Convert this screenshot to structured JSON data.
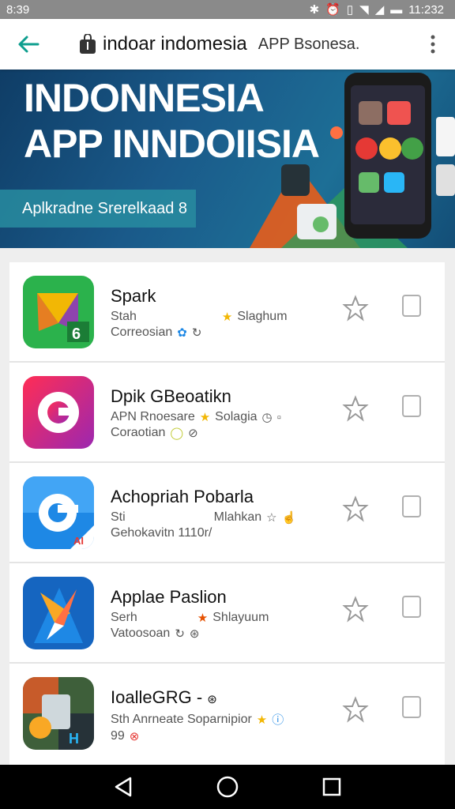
{
  "status_bar": {
    "left_text": "8:39",
    "time": "11:232",
    "icons": [
      "bluetooth-icon",
      "alarm-icon",
      "vibrate-icon",
      "wifi-icon",
      "signal-icon",
      "battery-icon"
    ]
  },
  "app_bar": {
    "title": "indoar indomesia",
    "subtitle": "APP Bsonesa."
  },
  "banner": {
    "line1": "INDONNESIA",
    "line2": "APP INNDOIISIA",
    "cta": "Aplkradne Srerelkaad 8"
  },
  "apps": [
    {
      "name": "Spark",
      "meta_left": "Stah",
      "meta_right": "Slaghum",
      "meta2": "Correosian",
      "icon_colors": [
        "#2bb24c",
        "#f2b705"
      ]
    },
    {
      "name": "Dpik GBeoatikn",
      "meta_left": "APN Rnoesare",
      "meta_right": "Solagia",
      "meta2": "Coraotian",
      "icon_colors": [
        "#e91e63",
        "#9c27b0"
      ]
    },
    {
      "name": "Achopriah Pobarla",
      "meta_left": "Sti",
      "meta_right": "Mlahkan",
      "meta2": "Gehokavitn 1110r/",
      "icon_colors": [
        "#1e88e5",
        "#42a5f5"
      ]
    },
    {
      "name": "Applae Paslion",
      "meta_left": "Serh",
      "meta_right": "Shlayuum",
      "meta2": "Vatoosoan",
      "icon_colors": [
        "#1565c0",
        "#ff7043"
      ]
    },
    {
      "name": "IoalleGRG -",
      "meta_left": "Sth Anrneate Soparnipior",
      "meta_right": "",
      "meta2": "99",
      "icon_colors": [
        "#3e5f3a",
        "#f9a825"
      ]
    }
  ],
  "colors": {
    "accent": "#0e9e8e",
    "banner": "#0f3d66",
    "nav": "#000000"
  }
}
